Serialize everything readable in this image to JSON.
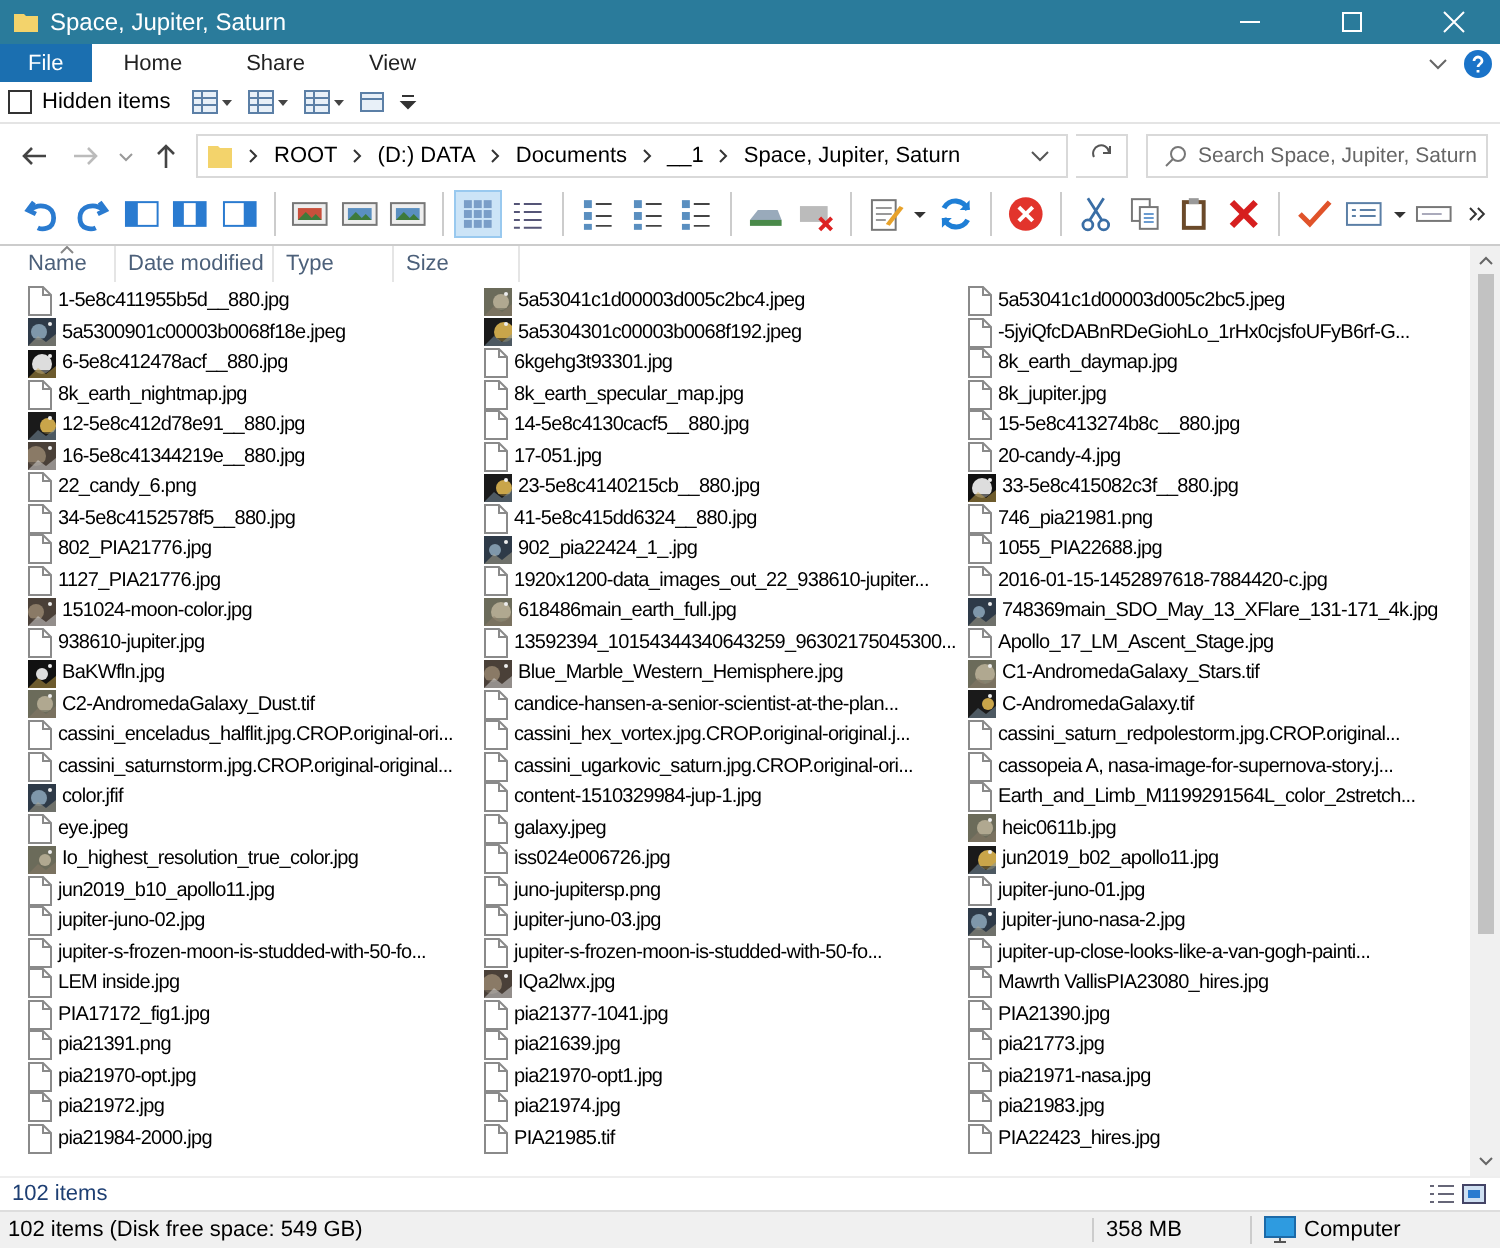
{
  "window": {
    "title": "Space, Jupiter, Saturn"
  },
  "ribbon": {
    "tabs": [
      {
        "label": "File",
        "selected": true
      },
      {
        "label": "Home",
        "selected": false
      },
      {
        "label": "Share",
        "selected": false
      },
      {
        "label": "View",
        "selected": false
      }
    ]
  },
  "quick_bar": {
    "hidden_items": {
      "label": "Hidden items",
      "checked": false
    }
  },
  "address": {
    "breadcrumbs": [
      "ROOT",
      "(D:) DATA",
      "Documents",
      "__1",
      "Space, Jupiter, Saturn"
    ],
    "search_placeholder": "Search Space, Jupiter, Saturn"
  },
  "toolbar": {
    "view_modes": [
      {
        "selected": true
      },
      {
        "selected": false
      }
    ]
  },
  "columns": [
    "Name",
    "Date modified",
    "Type",
    "Size"
  ],
  "files": [
    {
      "name": "1-5e8c411955b5d__880.jpg",
      "kind": "file"
    },
    {
      "name": "5a5300901c00003b0068f18e.jpeg",
      "kind": "thumbnail"
    },
    {
      "name": "6-5e8c412478acf__880.jpg",
      "kind": "thumbnail"
    },
    {
      "name": "8k_earth_nightmap.jpg",
      "kind": "file"
    },
    {
      "name": "12-5e8c412d78e91__880.jpg",
      "kind": "thumbnail"
    },
    {
      "name": "16-5e8c41344219e__880.jpg",
      "kind": "thumbnail"
    },
    {
      "name": "22_candy_6.png",
      "kind": "file"
    },
    {
      "name": "34-5e8c4152578f5__880.jpg",
      "kind": "file"
    },
    {
      "name": "802_PIA21776.jpg",
      "kind": "file"
    },
    {
      "name": "1127_PIA21776.jpg",
      "kind": "file"
    },
    {
      "name": "151024-moon-color.jpg",
      "kind": "thumbnail"
    },
    {
      "name": "938610-jupiter.jpg",
      "kind": "file"
    },
    {
      "name": "BaKWfln.jpg",
      "kind": "thumbnail"
    },
    {
      "name": "C2-AndromedaGalaxy_Dust.tif",
      "kind": "thumbnail"
    },
    {
      "name": "cassini_enceladus_halflit.jpg.CROP.original-ori...",
      "kind": "file"
    },
    {
      "name": "cassini_saturnstorm.jpg.CROP.original-original...",
      "kind": "file"
    },
    {
      "name": "color.jfif",
      "kind": "thumbnail"
    },
    {
      "name": "eye.jpeg",
      "kind": "file"
    },
    {
      "name": "Io_highest_resolution_true_color.jpg",
      "kind": "thumbnail"
    },
    {
      "name": "jun2019_b10_apollo11.jpg",
      "kind": "file"
    },
    {
      "name": "jupiter-juno-02.jpg",
      "kind": "file"
    },
    {
      "name": "jupiter-s-frozen-moon-is-studded-with-50-fo...",
      "kind": "file"
    },
    {
      "name": "LEM inside.jpg",
      "kind": "file"
    },
    {
      "name": "PIA17172_fig1.jpg",
      "kind": "file"
    },
    {
      "name": "pia21391.png",
      "kind": "file"
    },
    {
      "name": "pia21970-opt.jpg",
      "kind": "file"
    },
    {
      "name": "pia21972.jpg",
      "kind": "file"
    },
    {
      "name": "pia21984-2000.jpg",
      "kind": "file"
    },
    {
      "name": "5a53041c1d00003d005c2bc4.jpeg",
      "kind": "thumbnail"
    },
    {
      "name": "5a5304301c00003b0068f192.jpeg",
      "kind": "thumbnail"
    },
    {
      "name": "6kgehg3t93301.jpg",
      "kind": "file"
    },
    {
      "name": "8k_earth_specular_map.jpg",
      "kind": "file"
    },
    {
      "name": "14-5e8c4130cacf5__880.jpg",
      "kind": "file"
    },
    {
      "name": "17-051.jpg",
      "kind": "file"
    },
    {
      "name": "23-5e8c4140215cb__880.jpg",
      "kind": "thumbnail"
    },
    {
      "name": "41-5e8c415dd6324__880.jpg",
      "kind": "file"
    },
    {
      "name": "902_pia22424_1_.jpg",
      "kind": "thumbnail"
    },
    {
      "name": "1920x1200-data_images_out_22_938610-jupiter...",
      "kind": "file"
    },
    {
      "name": "618486main_earth_full.jpg",
      "kind": "thumbnail"
    },
    {
      "name": "13592394_10154344340643259_96302175045300...",
      "kind": "file"
    },
    {
      "name": "Blue_Marble_Western_Hemisphere.jpg",
      "kind": "thumbnail"
    },
    {
      "name": "candice-hansen-a-senior-scientist-at-the-plan...",
      "kind": "file"
    },
    {
      "name": "cassini_hex_vortex.jpg.CROP.original-original.j...",
      "kind": "file"
    },
    {
      "name": "cassini_ugarkovic_saturn.jpg.CROP.original-ori...",
      "kind": "file"
    },
    {
      "name": "content-1510329984-jup-1.jpg",
      "kind": "file"
    },
    {
      "name": "galaxy.jpeg",
      "kind": "file"
    },
    {
      "name": "iss024e006726.jpg",
      "kind": "file"
    },
    {
      "name": "juno-jupitersp.png",
      "kind": "file"
    },
    {
      "name": "jupiter-juno-03.jpg",
      "kind": "file"
    },
    {
      "name": "jupiter-s-frozen-moon-is-studded-with-50-fo...",
      "kind": "file"
    },
    {
      "name": "IQa2lwx.jpg",
      "kind": "thumbnail"
    },
    {
      "name": "pia21377-1041.jpg",
      "kind": "file"
    },
    {
      "name": "pia21639.jpg",
      "kind": "file"
    },
    {
      "name": "pia21970-opt1.jpg",
      "kind": "file"
    },
    {
      "name": "pia21974.jpg",
      "kind": "file"
    },
    {
      "name": "PIA21985.tif",
      "kind": "file"
    },
    {
      "name": "5a53041c1d00003d005c2bc5.jpeg",
      "kind": "file"
    },
    {
      "name": "-5jyiQfcDABnRDeGiohLo_1rHx0cjsfoUFyB6rf-G...",
      "kind": "file"
    },
    {
      "name": "8k_earth_daymap.jpg",
      "kind": "file"
    },
    {
      "name": "8k_jupiter.jpg",
      "kind": "file"
    },
    {
      "name": "15-5e8c413274b8c__880.jpg",
      "kind": "file"
    },
    {
      "name": "20-candy-4.jpg",
      "kind": "file"
    },
    {
      "name": "33-5e8c415082c3f__880.jpg",
      "kind": "thumbnail"
    },
    {
      "name": "746_pia21981.png",
      "kind": "file"
    },
    {
      "name": "1055_PIA22688.jpg",
      "kind": "file"
    },
    {
      "name": "2016-01-15-1452897618-7884420-c.jpg",
      "kind": "file"
    },
    {
      "name": "748369main_SDO_May_13_XFlare_131-171_4k.jpg",
      "kind": "thumbnail"
    },
    {
      "name": "Apollo_17_LM_Ascent_Stage.jpg",
      "kind": "file"
    },
    {
      "name": "C1-AndromedaGalaxy_Stars.tif",
      "kind": "thumbnail"
    },
    {
      "name": "C-AndromedaGalaxy.tif",
      "kind": "thumbnail"
    },
    {
      "name": "cassini_saturn_redpolestorm.jpg.CROP.original...",
      "kind": "file"
    },
    {
      "name": "cassopeia A, nasa-image-for-supernova-story.j...",
      "kind": "file"
    },
    {
      "name": "Earth_and_Limb_M1199291564L_color_2stretch...",
      "kind": "file"
    },
    {
      "name": "heic0611b.jpg",
      "kind": "thumbnail"
    },
    {
      "name": "jun2019_b02_apollo11.jpg",
      "kind": "thumbnail"
    },
    {
      "name": "jupiter-juno-01.jpg",
      "kind": "file"
    },
    {
      "name": "jupiter-juno-nasa-2.jpg",
      "kind": "thumbnail"
    },
    {
      "name": "jupiter-up-close-looks-like-a-van-gogh-painti...",
      "kind": "file"
    },
    {
      "name": "Mawrth VallisPIA23080_hires.jpg",
      "kind": "file"
    },
    {
      "name": "PIA21390.jpg",
      "kind": "file"
    },
    {
      "name": "pia21773.jpg",
      "kind": "file"
    },
    {
      "name": "pia21971-nasa.jpg",
      "kind": "file"
    },
    {
      "name": "pia21983.jpg",
      "kind": "file"
    },
    {
      "name": "PIA22423_hires.jpg",
      "kind": "file"
    }
  ],
  "item_count": "102 items",
  "status_bar": {
    "summary": "102 items (Disk free space: 549 GB)",
    "size": "358 MB",
    "location": "Computer"
  }
}
